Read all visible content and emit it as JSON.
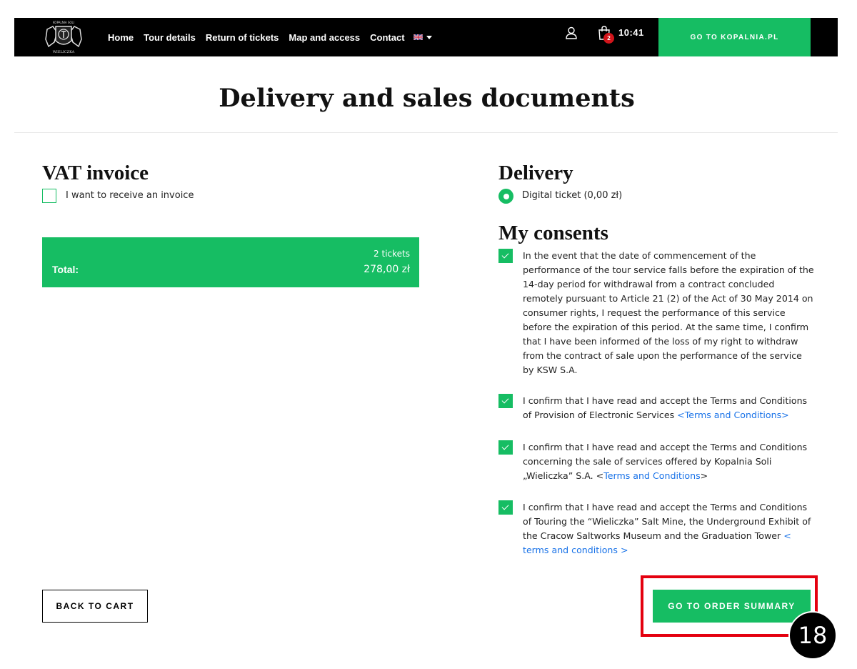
{
  "nav": {
    "links": [
      "Home",
      "Tour details",
      "Return of tickets",
      "Map and access",
      "Contact"
    ],
    "language": "EN",
    "cart_count": "2",
    "timer": "10:41",
    "cta": "GO TO KOPALNIA.PL"
  },
  "page_title": "Delivery and sales documents",
  "vat": {
    "heading": "VAT invoice",
    "checkbox_label": "I want to receive an invoice",
    "checked": false
  },
  "total": {
    "label": "Total:",
    "tickets": "2 tickets",
    "amount": "278,00 zł"
  },
  "delivery": {
    "heading": "Delivery",
    "option": "Digital ticket (0,00 zł)",
    "selected": true
  },
  "consents": {
    "heading": "My consents",
    "items": [
      {
        "text": "In the event that the date of commencement of the performance of the tour service falls before the expiration of the 14-day period for withdrawal from a contract concluded remotely pursuant to Article 21 (2) of the Act of 30 May 2014 on consumer rights, I request the performance of this service before the expiration of this period. At the same time, I confirm that I have been informed of the loss of my right to withdraw from the contract of sale upon the performance of the service by KSW S.A.",
        "checked": true
      },
      {
        "text": "I confirm that I have read and accept the Terms and Conditions of Provision of Electronic Services ",
        "link": "<Terms and Conditions>",
        "checked": true
      },
      {
        "text": "I confirm that I have read and accept the Terms and Conditions concerning the sale of services offered by Kopalnia Soli „Wieliczka” S.A. <",
        "link": "Terms and Conditions",
        "suffix": ">",
        "checked": true
      },
      {
        "text": "I confirm that I have read and accept the Terms and Conditions of Touring the “Wieliczka” Salt Mine, the Underground Exhibit of the Cracow Saltworks Museum and the Graduation Tower ",
        "link": "< terms and conditions >",
        "checked": true
      }
    ]
  },
  "buttons": {
    "back": "BACK TO CART",
    "summary": "GO TO ORDER SUMMARY"
  },
  "annotation": {
    "step": "18",
    "highlight_color": "#e4000f"
  },
  "colors": {
    "accent": "#16bd63",
    "nav_bg": "#000000",
    "link": "#1a73e8",
    "badge": "#d2151b"
  },
  "icons": {
    "logo": "salt-mine-crest-logo",
    "user": "user-icon",
    "cart": "shopping-bag-icon",
    "flag": "uk-flag-icon"
  }
}
